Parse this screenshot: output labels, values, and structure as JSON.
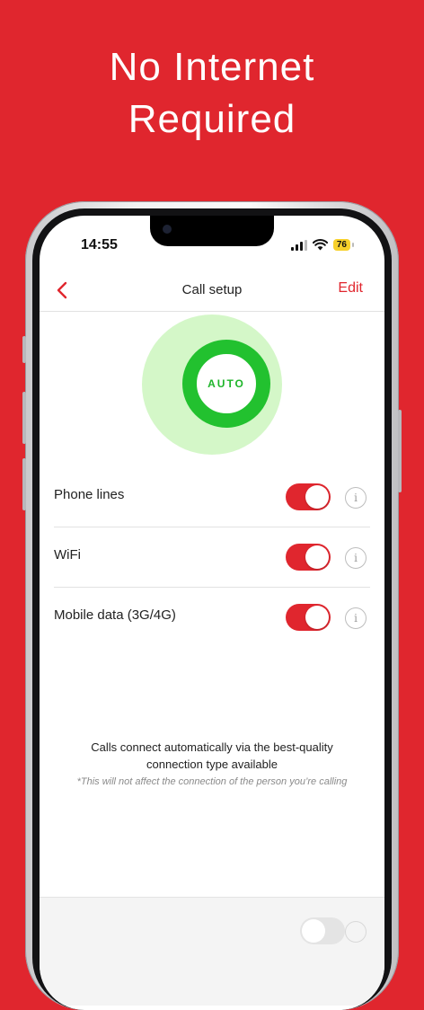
{
  "headline": {
    "line1": "No Internet",
    "line2": "Required"
  },
  "status_bar": {
    "time": "14:55",
    "battery": "76"
  },
  "nav": {
    "title": "Call setup",
    "edit_label": "Edit"
  },
  "mode": {
    "label": "AUTO"
  },
  "connections": [
    {
      "label": "Phone lines",
      "enabled": true
    },
    {
      "label": "WiFi",
      "enabled": true
    },
    {
      "label": "Mobile data (3G/4G)",
      "enabled": true
    }
  ],
  "info_glyph": "i",
  "footer": {
    "description": "Calls connect automatically via the best-quality connection type available",
    "note": "*This will not affect the connection of the person you’re calling"
  },
  "colors": {
    "brand_red": "#e0262e",
    "auto_green": "#22c12f",
    "auto_halo": "#d4f7c8"
  }
}
